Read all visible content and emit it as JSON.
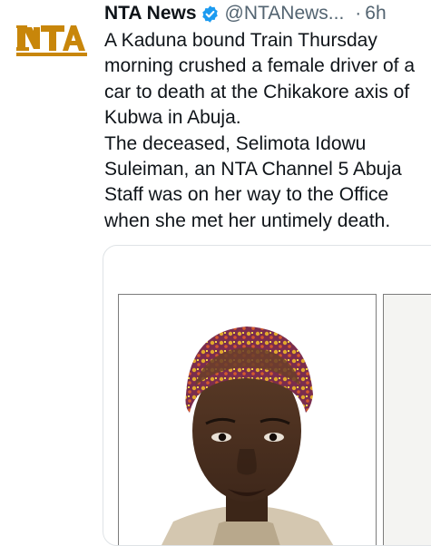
{
  "header": {
    "display_name": "NTA News",
    "handle": "@NTANews...",
    "separator": "·",
    "time": "6h"
  },
  "icons": {
    "verified": "verified-badge-icon",
    "more": "more-options-icon"
  },
  "colors": {
    "verified": "#1d9bf0",
    "brand_logo": "#c8860a",
    "muted_text": "#536471"
  },
  "avatar": {
    "logo_text": "NTA"
  },
  "tweet": {
    "paragraph_1": "A Kaduna bound Train Thursday morning crushed a female driver of a car to death at the Chikakore axis of Kubwa in Abuja.",
    "paragraph_2": "The deceased, Selimota Idowu Suleiman, an NTA Channel 5 Abuja Staff was on her way to the Office when she met her untimely death."
  }
}
